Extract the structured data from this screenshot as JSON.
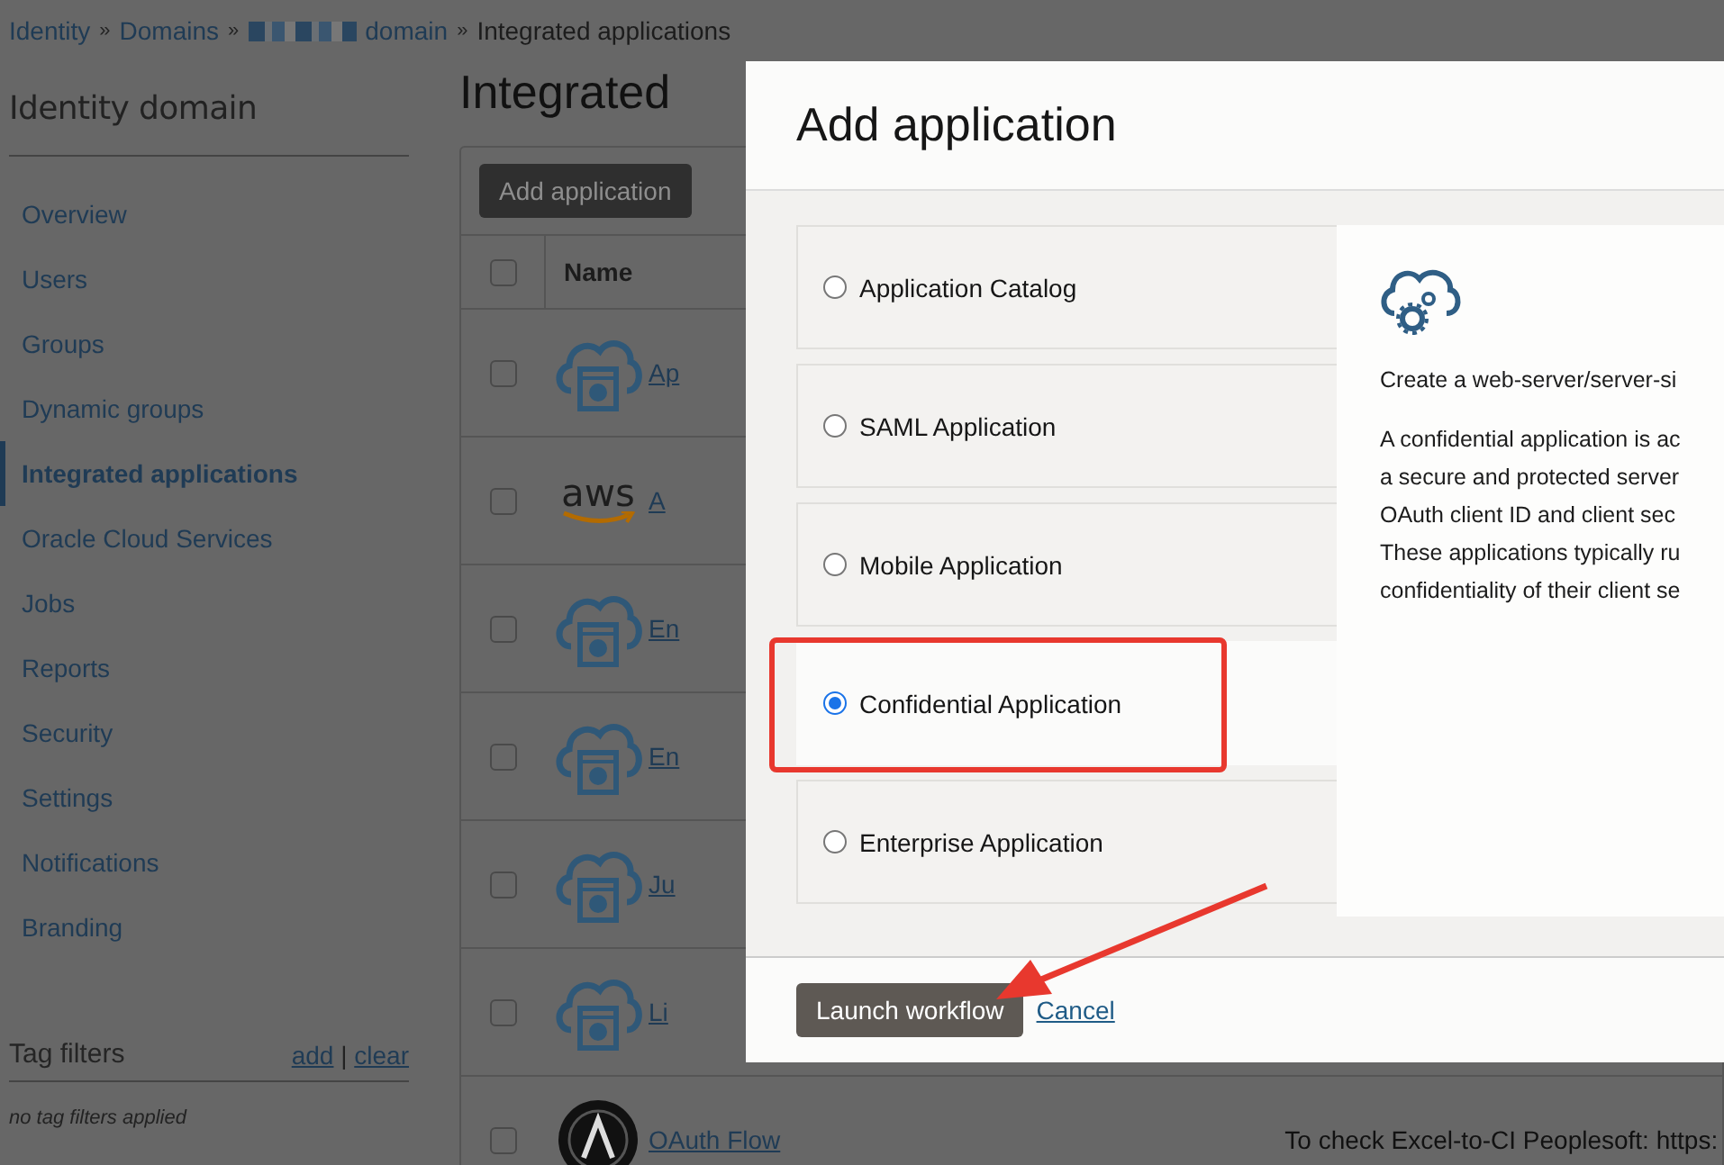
{
  "breadcrumb": [
    {
      "label": "Identity",
      "kind": "link"
    },
    {
      "label": "»",
      "kind": "separator"
    },
    {
      "label": "Domains",
      "kind": "link"
    },
    {
      "label": "»",
      "kind": "separator"
    },
    {
      "kind": "redacted"
    },
    {
      "label": "domain",
      "kind": "link"
    },
    {
      "label": "»",
      "kind": "separator"
    },
    {
      "label": "Integrated applications",
      "kind": "current"
    }
  ],
  "sidebar": {
    "title": "Identity domain",
    "items": [
      {
        "label": "Overview",
        "selected": false
      },
      {
        "label": "Users",
        "selected": false
      },
      {
        "label": "Groups",
        "selected": false
      },
      {
        "label": "Dynamic groups",
        "selected": false
      },
      {
        "label": "Integrated applications",
        "selected": true
      },
      {
        "label": "Oracle Cloud Services",
        "selected": false
      },
      {
        "label": "Jobs",
        "selected": false
      },
      {
        "label": "Reports",
        "selected": false
      },
      {
        "label": "Security",
        "selected": false
      },
      {
        "label": "Settings",
        "selected": false
      },
      {
        "label": "Notifications",
        "selected": false
      },
      {
        "label": "Branding",
        "selected": false
      }
    ],
    "tag_filters": {
      "title": "Tag filters",
      "add": "add",
      "separator": "|",
      "clear": "clear",
      "empty": "no tag filters applied"
    }
  },
  "main": {
    "title": "Integrated",
    "add_button": "Add application",
    "table": {
      "select_all_checked": false,
      "columns": [
        "Name"
      ],
      "rows": [
        {
          "kind": "cloud",
          "name": "Ap",
          "checked": false
        },
        {
          "kind": "aws",
          "logo_text": "aws",
          "name": "A",
          "checked": false
        },
        {
          "kind": "cloud",
          "name": "En",
          "checked": false
        },
        {
          "kind": "cloud",
          "name": "En",
          "checked": false
        },
        {
          "kind": "cloud",
          "name": "Ju",
          "checked": false
        },
        {
          "kind": "cloud",
          "name": "Li",
          "checked": false
        },
        {
          "kind": "badge",
          "name": "OAuth Flow",
          "column_3": "To check Excel-to-CI Peoplesoft: https:",
          "checked": false
        }
      ]
    }
  },
  "dialog": {
    "title": "Add application",
    "options": [
      {
        "label": "Application Catalog",
        "selected": false
      },
      {
        "label": "SAML Application",
        "selected": false
      },
      {
        "label": "Mobile Application",
        "selected": false
      },
      {
        "label": "Confidential Application",
        "selected": true
      },
      {
        "label": "Enterprise Application",
        "selected": false
      }
    ],
    "description": {
      "summary": "Create a web-server/server-si",
      "lines": [
        "A confidential application is ac",
        "a secure and protected server",
        "OAuth client ID and client sec",
        "These applications typically ru",
        "confidentiality of their client se"
      ]
    },
    "primary_button": "Launch workflow",
    "cancel_link": "Cancel"
  }
}
